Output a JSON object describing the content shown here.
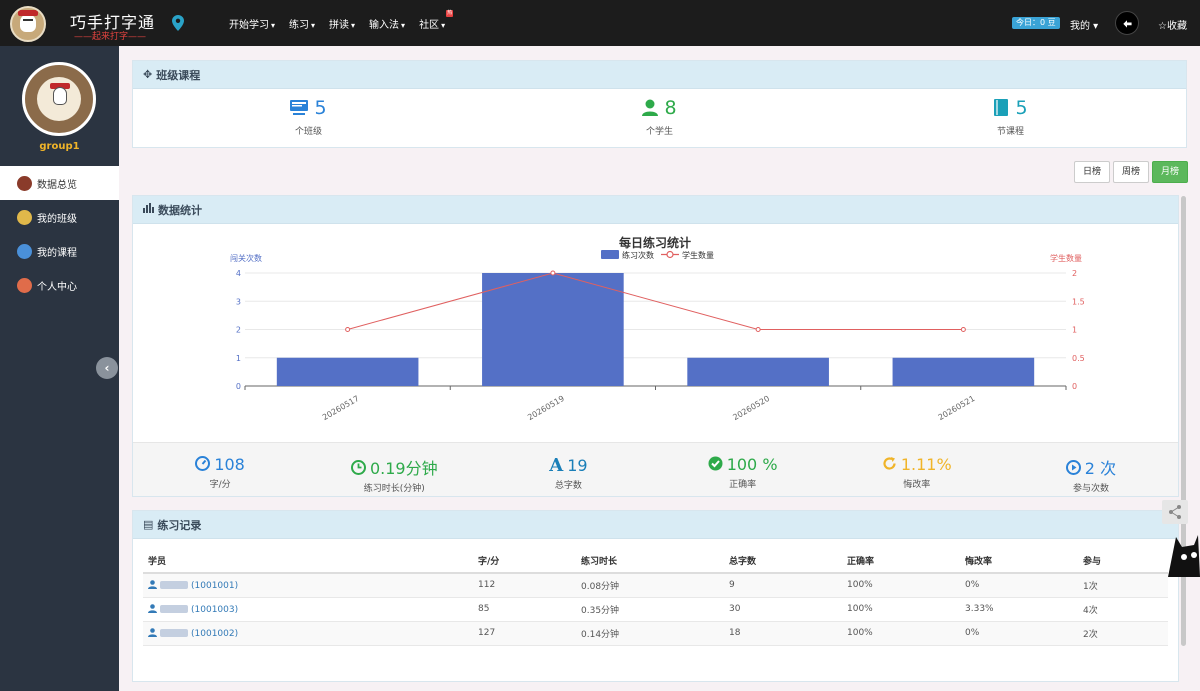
{
  "brand": {
    "title": "巧手打字通",
    "subtitle": "——起来打字——"
  },
  "nav": [
    {
      "label": "开始学习",
      "caret": "▾"
    },
    {
      "label": "练习",
      "caret": "▾"
    },
    {
      "label": "拼读",
      "caret": "▾"
    },
    {
      "label": "输入法",
      "caret": "▾"
    },
    {
      "label": "社区",
      "caret": "▾",
      "badge": "热"
    }
  ],
  "header_right": {
    "today": "今日：0 豆",
    "mine": "我的 ▾",
    "collect": "☆收藏"
  },
  "sidebar": {
    "group_name": "group1",
    "items": [
      {
        "label": "数据总览",
        "active": true,
        "color": "#8a3b2a"
      },
      {
        "label": "我的班级",
        "active": false,
        "color": "#e0b84a"
      },
      {
        "label": "我的课程",
        "active": false,
        "color": "#4a90d9"
      },
      {
        "label": "个人中心",
        "active": false,
        "color": "#e06c4a"
      }
    ],
    "collapse": "‹"
  },
  "class_panel": {
    "title": "班级课程",
    "items": [
      {
        "value": "5",
        "label": "个班级",
        "color": "#2a82d8",
        "icon": "monitor-icon"
      },
      {
        "value": "8",
        "label": "个学生",
        "color": "#2eaa4a",
        "icon": "user-icon"
      },
      {
        "value": "5",
        "label": "节课程",
        "color": "#1aa0b8",
        "icon": "book-icon"
      }
    ]
  },
  "range_buttons": [
    {
      "label": "日榜",
      "active": false
    },
    {
      "label": "周榜",
      "active": false
    },
    {
      "label": "月榜",
      "active": true
    }
  ],
  "stats_panel": {
    "title": "数据统计"
  },
  "chart_data": {
    "type": "bar",
    "title": "每日练习统计",
    "categories": [
      "20260517",
      "20260519",
      "20260520",
      "20260521"
    ],
    "series": [
      {
        "name": "练习次数",
        "type": "bar",
        "values": [
          1,
          4,
          1,
          1
        ],
        "color": "#5470c6",
        "axis": "left"
      },
      {
        "name": "学生数量",
        "type": "line",
        "values": [
          1,
          2,
          1,
          1
        ],
        "color": "#e06060",
        "axis": "right"
      }
    ],
    "ylabel": "闯关次数",
    "ylabel_right": "学生数量",
    "ylim": [
      0,
      4
    ],
    "ylim_right": [
      0,
      2
    ],
    "yticks": [
      "0",
      "1",
      "2",
      "3",
      "4"
    ],
    "yticks_right": [
      "0",
      "0.5",
      "1",
      "1.5",
      "2"
    ],
    "legend": "top-center",
    "grid": true
  },
  "metrics": [
    {
      "value": "108",
      "label": "字/分",
      "color": "#2a82d8",
      "icon": "speedometer-icon"
    },
    {
      "value": "0.19分钟",
      "label": "练习时长(分钟)",
      "color": "#2eaa4a",
      "icon": "clock-icon"
    },
    {
      "value": "19",
      "label": "总字数",
      "color": "#1a7fb8",
      "icon": "font-icon",
      "glyph": "A"
    },
    {
      "value": "100 %",
      "label": "正确率",
      "color": "#2eaa4a",
      "icon": "check-circle-icon"
    },
    {
      "value": "1.11%",
      "label": "悔改率",
      "color": "#f0b429",
      "icon": "refresh-icon"
    },
    {
      "value": "2 次",
      "label": "参与次数",
      "color": "#2a82d8",
      "icon": "play-circle-icon"
    }
  ],
  "records_panel": {
    "title": "练习记录",
    "columns": [
      "学员",
      "字/分",
      "练习时长",
      "总字数",
      "正确率",
      "悔改率",
      "参与"
    ],
    "rows": [
      {
        "id": "(1001001)",
        "speed": "112",
        "duration": "0.08分钟",
        "chars": "9",
        "accuracy": "100%",
        "revise": "0%",
        "times": "1次"
      },
      {
        "id": "(1001003)",
        "speed": "85",
        "duration": "0.35分钟",
        "chars": "30",
        "accuracy": "100%",
        "revise": "3.33%",
        "times": "4次"
      },
      {
        "id": "(1001002)",
        "speed": "127",
        "duration": "0.14分钟",
        "chars": "18",
        "accuracy": "100%",
        "revise": "0%",
        "times": "2次"
      }
    ]
  }
}
